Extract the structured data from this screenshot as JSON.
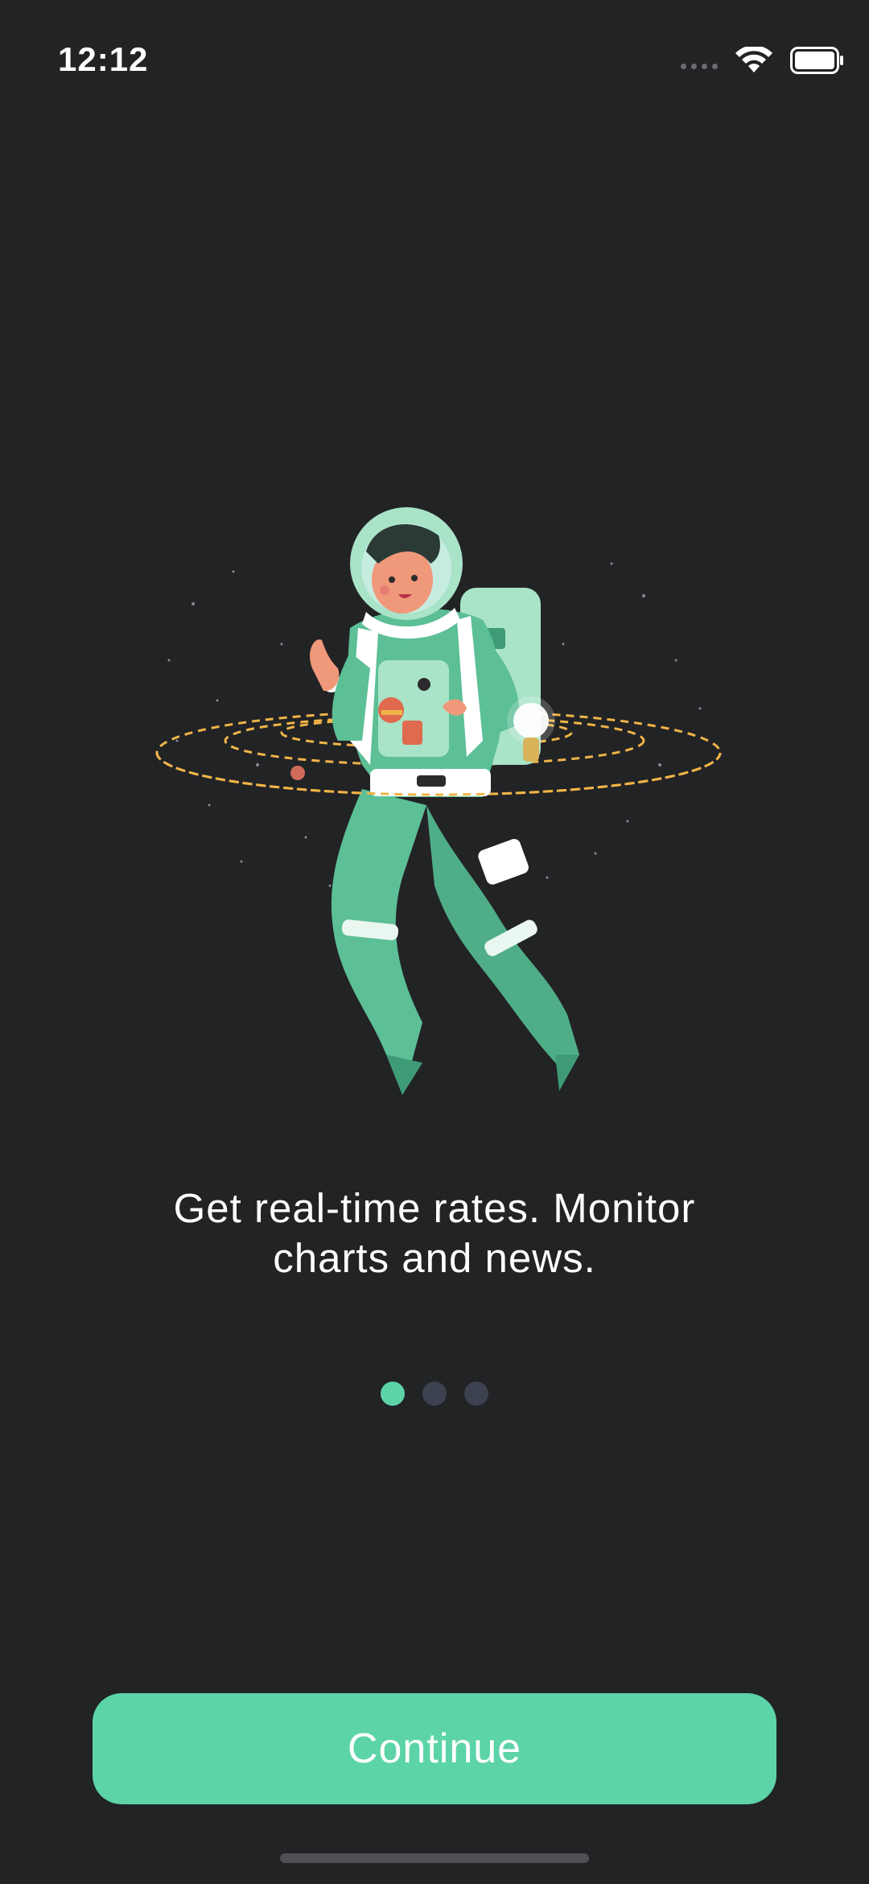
{
  "status_bar": {
    "time": "12:12",
    "icons": [
      "cellular-signal-icon",
      "wifi-icon",
      "battery-icon"
    ]
  },
  "illustration": {
    "subject": "astronaut-illustration",
    "colors": {
      "suit": "#5cbf96",
      "suit_dark": "#3f9b76",
      "orbit": "#f0b447"
    }
  },
  "onboarding": {
    "tagline_line1": "Get real-time rates. Monitor",
    "tagline_line2": "charts and news.",
    "page_count": 3,
    "active_page": 1
  },
  "actions": {
    "continue_label": "Continue"
  },
  "colors": {
    "background": "#222325",
    "accent": "#5cd4a8",
    "inactive_dot": "#3d4250"
  }
}
